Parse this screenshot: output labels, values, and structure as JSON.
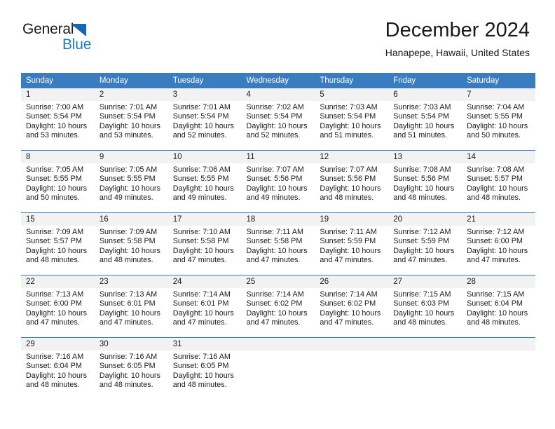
{
  "logo": {
    "primary_text": "General",
    "secondary_text": "Blue",
    "triangle_color": "#1667b2",
    "secondary_color": "#1f7ac4"
  },
  "header": {
    "title": "December 2024",
    "subtitle": "Hanapepe, Hawaii, United States"
  },
  "theme": {
    "header_bg": "#3a7cc0",
    "header_text": "#ffffff",
    "daynum_bg": "#f2f2f2",
    "cell_bg": "#ffffff",
    "text": "#1a1a1a"
  },
  "calendar": {
    "weekdays": [
      "Sunday",
      "Monday",
      "Tuesday",
      "Wednesday",
      "Thursday",
      "Friday",
      "Saturday"
    ],
    "weeks": [
      [
        {
          "day": "1",
          "sunrise": "Sunrise: 7:00 AM",
          "sunset": "Sunset: 5:54 PM",
          "daylight_1": "Daylight: 10 hours",
          "daylight_2": "and 53 minutes."
        },
        {
          "day": "2",
          "sunrise": "Sunrise: 7:01 AM",
          "sunset": "Sunset: 5:54 PM",
          "daylight_1": "Daylight: 10 hours",
          "daylight_2": "and 53 minutes."
        },
        {
          "day": "3",
          "sunrise": "Sunrise: 7:01 AM",
          "sunset": "Sunset: 5:54 PM",
          "daylight_1": "Daylight: 10 hours",
          "daylight_2": "and 52 minutes."
        },
        {
          "day": "4",
          "sunrise": "Sunrise: 7:02 AM",
          "sunset": "Sunset: 5:54 PM",
          "daylight_1": "Daylight: 10 hours",
          "daylight_2": "and 52 minutes."
        },
        {
          "day": "5",
          "sunrise": "Sunrise: 7:03 AM",
          "sunset": "Sunset: 5:54 PM",
          "daylight_1": "Daylight: 10 hours",
          "daylight_2": "and 51 minutes."
        },
        {
          "day": "6",
          "sunrise": "Sunrise: 7:03 AM",
          "sunset": "Sunset: 5:54 PM",
          "daylight_1": "Daylight: 10 hours",
          "daylight_2": "and 51 minutes."
        },
        {
          "day": "7",
          "sunrise": "Sunrise: 7:04 AM",
          "sunset": "Sunset: 5:55 PM",
          "daylight_1": "Daylight: 10 hours",
          "daylight_2": "and 50 minutes."
        }
      ],
      [
        {
          "day": "8",
          "sunrise": "Sunrise: 7:05 AM",
          "sunset": "Sunset: 5:55 PM",
          "daylight_1": "Daylight: 10 hours",
          "daylight_2": "and 50 minutes."
        },
        {
          "day": "9",
          "sunrise": "Sunrise: 7:05 AM",
          "sunset": "Sunset: 5:55 PM",
          "daylight_1": "Daylight: 10 hours",
          "daylight_2": "and 49 minutes."
        },
        {
          "day": "10",
          "sunrise": "Sunrise: 7:06 AM",
          "sunset": "Sunset: 5:55 PM",
          "daylight_1": "Daylight: 10 hours",
          "daylight_2": "and 49 minutes."
        },
        {
          "day": "11",
          "sunrise": "Sunrise: 7:07 AM",
          "sunset": "Sunset: 5:56 PM",
          "daylight_1": "Daylight: 10 hours",
          "daylight_2": "and 49 minutes."
        },
        {
          "day": "12",
          "sunrise": "Sunrise: 7:07 AM",
          "sunset": "Sunset: 5:56 PM",
          "daylight_1": "Daylight: 10 hours",
          "daylight_2": "and 48 minutes."
        },
        {
          "day": "13",
          "sunrise": "Sunrise: 7:08 AM",
          "sunset": "Sunset: 5:56 PM",
          "daylight_1": "Daylight: 10 hours",
          "daylight_2": "and 48 minutes."
        },
        {
          "day": "14",
          "sunrise": "Sunrise: 7:08 AM",
          "sunset": "Sunset: 5:57 PM",
          "daylight_1": "Daylight: 10 hours",
          "daylight_2": "and 48 minutes."
        }
      ],
      [
        {
          "day": "15",
          "sunrise": "Sunrise: 7:09 AM",
          "sunset": "Sunset: 5:57 PM",
          "daylight_1": "Daylight: 10 hours",
          "daylight_2": "and 48 minutes."
        },
        {
          "day": "16",
          "sunrise": "Sunrise: 7:09 AM",
          "sunset": "Sunset: 5:58 PM",
          "daylight_1": "Daylight: 10 hours",
          "daylight_2": "and 48 minutes."
        },
        {
          "day": "17",
          "sunrise": "Sunrise: 7:10 AM",
          "sunset": "Sunset: 5:58 PM",
          "daylight_1": "Daylight: 10 hours",
          "daylight_2": "and 47 minutes."
        },
        {
          "day": "18",
          "sunrise": "Sunrise: 7:11 AM",
          "sunset": "Sunset: 5:58 PM",
          "daylight_1": "Daylight: 10 hours",
          "daylight_2": "and 47 minutes."
        },
        {
          "day": "19",
          "sunrise": "Sunrise: 7:11 AM",
          "sunset": "Sunset: 5:59 PM",
          "daylight_1": "Daylight: 10 hours",
          "daylight_2": "and 47 minutes."
        },
        {
          "day": "20",
          "sunrise": "Sunrise: 7:12 AM",
          "sunset": "Sunset: 5:59 PM",
          "daylight_1": "Daylight: 10 hours",
          "daylight_2": "and 47 minutes."
        },
        {
          "day": "21",
          "sunrise": "Sunrise: 7:12 AM",
          "sunset": "Sunset: 6:00 PM",
          "daylight_1": "Daylight: 10 hours",
          "daylight_2": "and 47 minutes."
        }
      ],
      [
        {
          "day": "22",
          "sunrise": "Sunrise: 7:13 AM",
          "sunset": "Sunset: 6:00 PM",
          "daylight_1": "Daylight: 10 hours",
          "daylight_2": "and 47 minutes."
        },
        {
          "day": "23",
          "sunrise": "Sunrise: 7:13 AM",
          "sunset": "Sunset: 6:01 PM",
          "daylight_1": "Daylight: 10 hours",
          "daylight_2": "and 47 minutes."
        },
        {
          "day": "24",
          "sunrise": "Sunrise: 7:14 AM",
          "sunset": "Sunset: 6:01 PM",
          "daylight_1": "Daylight: 10 hours",
          "daylight_2": "and 47 minutes."
        },
        {
          "day": "25",
          "sunrise": "Sunrise: 7:14 AM",
          "sunset": "Sunset: 6:02 PM",
          "daylight_1": "Daylight: 10 hours",
          "daylight_2": "and 47 minutes."
        },
        {
          "day": "26",
          "sunrise": "Sunrise: 7:14 AM",
          "sunset": "Sunset: 6:02 PM",
          "daylight_1": "Daylight: 10 hours",
          "daylight_2": "and 47 minutes."
        },
        {
          "day": "27",
          "sunrise": "Sunrise: 7:15 AM",
          "sunset": "Sunset: 6:03 PM",
          "daylight_1": "Daylight: 10 hours",
          "daylight_2": "and 48 minutes."
        },
        {
          "day": "28",
          "sunrise": "Sunrise: 7:15 AM",
          "sunset": "Sunset: 6:04 PM",
          "daylight_1": "Daylight: 10 hours",
          "daylight_2": "and 48 minutes."
        }
      ],
      [
        {
          "day": "29",
          "sunrise": "Sunrise: 7:16 AM",
          "sunset": "Sunset: 6:04 PM",
          "daylight_1": "Daylight: 10 hours",
          "daylight_2": "and 48 minutes."
        },
        {
          "day": "30",
          "sunrise": "Sunrise: 7:16 AM",
          "sunset": "Sunset: 6:05 PM",
          "daylight_1": "Daylight: 10 hours",
          "daylight_2": "and 48 minutes."
        },
        {
          "day": "31",
          "sunrise": "Sunrise: 7:16 AM",
          "sunset": "Sunset: 6:05 PM",
          "daylight_1": "Daylight: 10 hours",
          "daylight_2": "and 48 minutes."
        },
        {
          "day": "",
          "sunrise": "",
          "sunset": "",
          "daylight_1": "",
          "daylight_2": ""
        },
        {
          "day": "",
          "sunrise": "",
          "sunset": "",
          "daylight_1": "",
          "daylight_2": ""
        },
        {
          "day": "",
          "sunrise": "",
          "sunset": "",
          "daylight_1": "",
          "daylight_2": ""
        },
        {
          "day": "",
          "sunrise": "",
          "sunset": "",
          "daylight_1": "",
          "daylight_2": ""
        }
      ]
    ]
  }
}
